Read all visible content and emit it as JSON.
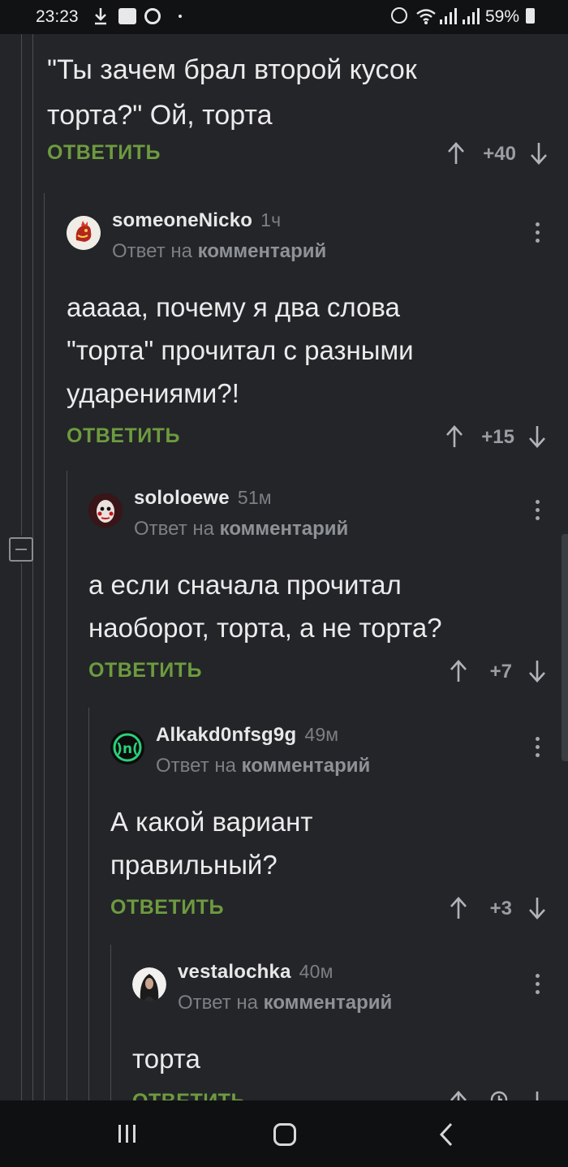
{
  "status_bar": {
    "time": "23:23",
    "battery": "59%",
    "icons": [
      "download-icon",
      "notification-box-icon",
      "chrome-icon",
      "alarm-icon",
      "wifi-icon",
      "signal-icon",
      "signal-icon",
      "battery-icon"
    ]
  },
  "parent_comment": {
    "text": "\"Ты зачем брал второй кусок\nторта?\" Ой, торта",
    "reply_label": "ОТВЕТИТЬ",
    "score": "+40"
  },
  "comments": [
    {
      "username": "someoneNicko",
      "time": "1ч",
      "reply_prefix": "Ответ на",
      "reply_target": "комментарий",
      "text": "ааааа, почему я два слова\n\"торта\" прочитал с разными\nударениями?!",
      "reply_label": "ОТВЕТИТЬ",
      "score": "+15"
    },
    {
      "username": "sololoewe",
      "time": "51м",
      "reply_prefix": "Ответ на",
      "reply_target": "комментарий",
      "text": "а если сначала прочитал\nнаоборот, торта, а не торта?",
      "reply_label": "ОТВЕТИТЬ",
      "score": "+7"
    },
    {
      "username": "Alkakd0nfsg9g",
      "time": "49м",
      "reply_prefix": "Ответ на",
      "reply_target": "комментарий",
      "text": "А какой вариант\nправильный?",
      "reply_label": "ОТВЕТИТЬ",
      "score": "+3"
    },
    {
      "username": "vestalochka",
      "time": "40м",
      "reply_prefix": "Ответ на",
      "reply_target": "комментарий",
      "text": "торта",
      "reply_label": "ОТВЕТИТЬ",
      "score": ""
    }
  ],
  "colors": {
    "background": "#232528",
    "reply_green": "#6d9b3f",
    "muted_text": "#7c7f84",
    "status_bar": "#111214",
    "nav_bar": "#0f1012"
  }
}
